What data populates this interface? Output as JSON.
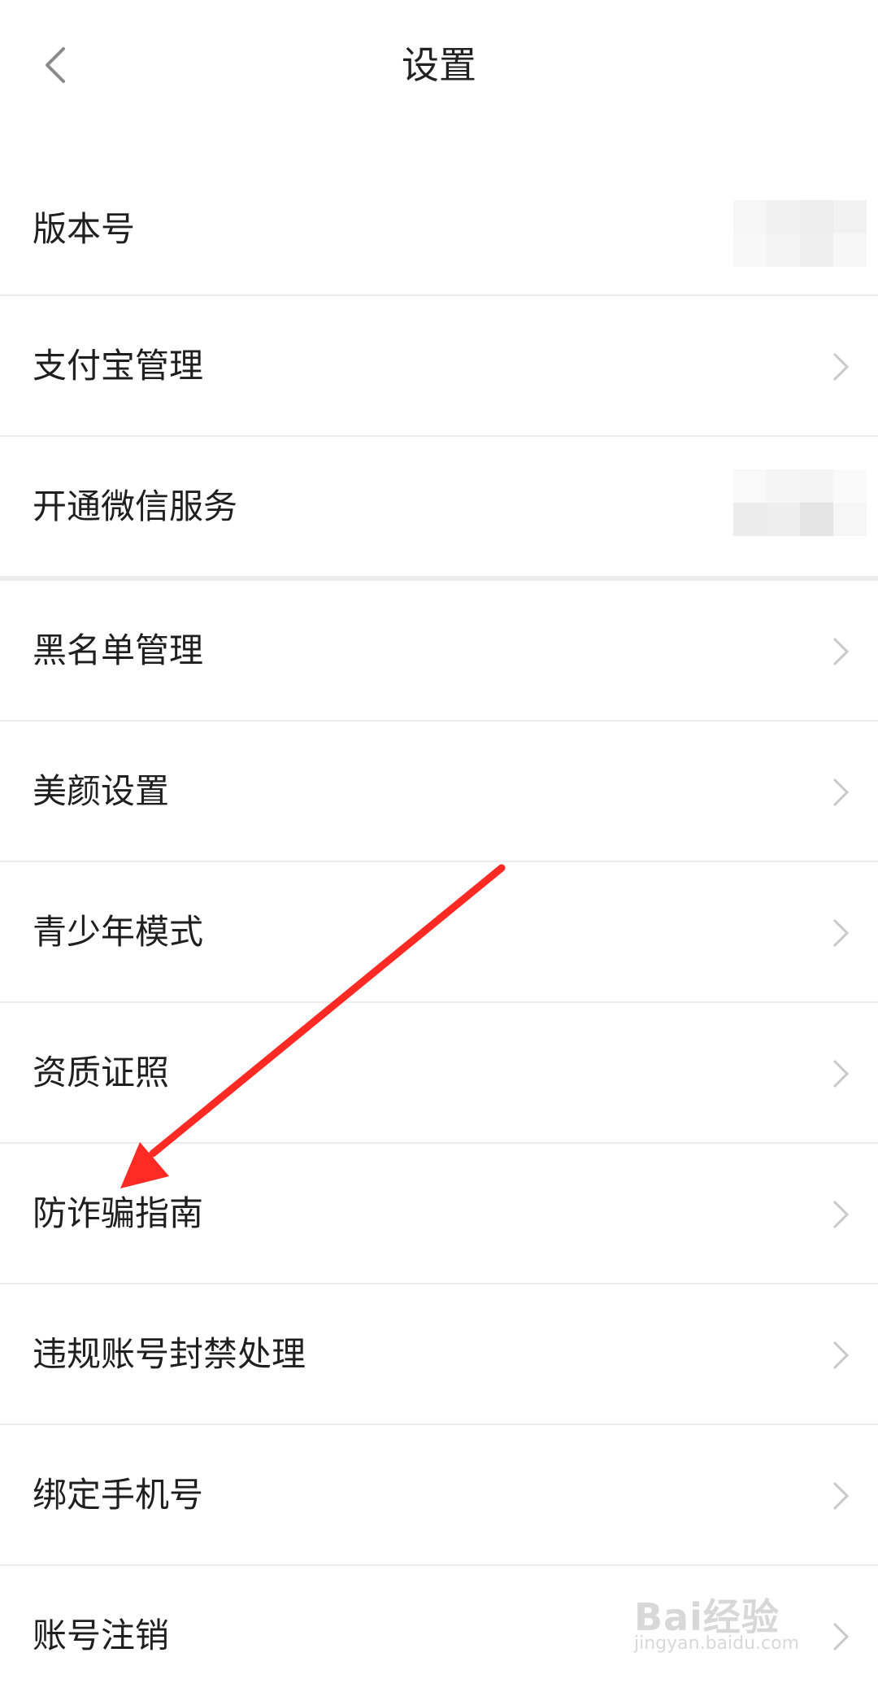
{
  "header": {
    "title": "设置",
    "back_icon": "chevron-left-icon"
  },
  "settings": {
    "items": [
      {
        "label": "版本号",
        "trailing": "redacted-value"
      },
      {
        "label": "支付宝管理",
        "trailing": "chevron-right-icon"
      },
      {
        "label": "开通微信服务",
        "trailing": "redacted-value"
      },
      {
        "label": "黑名单管理",
        "trailing": "chevron-right-icon"
      },
      {
        "label": "美颜设置",
        "trailing": "chevron-right-icon"
      },
      {
        "label": "青少年模式",
        "trailing": "chevron-right-icon"
      },
      {
        "label": "资质证照",
        "trailing": "chevron-right-icon"
      },
      {
        "label": "防诈骗指南",
        "trailing": "chevron-right-icon"
      },
      {
        "label": "违规账号封禁处理",
        "trailing": "chevron-right-icon"
      },
      {
        "label": "绑定手机号",
        "trailing": "chevron-right-icon"
      },
      {
        "label": "账号注销",
        "trailing": "chevron-right-icon"
      }
    ]
  },
  "annotation": {
    "icon": "red-arrow-icon",
    "color": "#ff2a23",
    "points_to": "防诈骗指南"
  },
  "watermark": {
    "logo": "Bai经验",
    "url": "jingyan.baidu.com"
  },
  "colors": {
    "divider": "#ececec",
    "chevron": "#c9c9c9",
    "text": "#1f1f1f"
  }
}
